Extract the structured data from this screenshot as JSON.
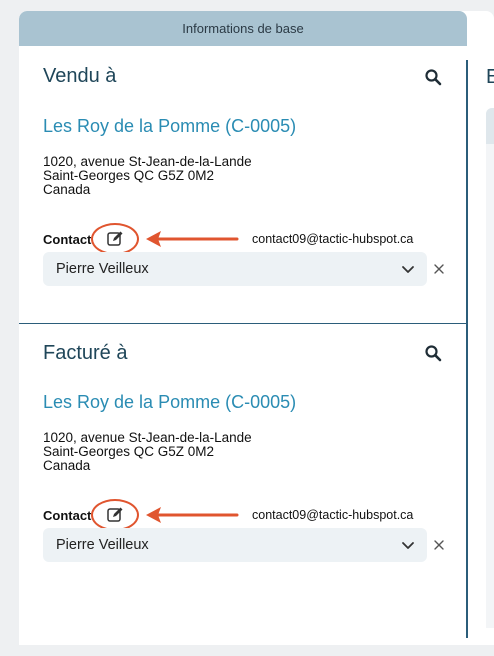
{
  "header": {
    "title": "Informations de base"
  },
  "right_column": {
    "title_fragment": "E"
  },
  "sold_to": {
    "title": "Vendu à",
    "company": "Les Roy de la Pomme (C-0005)",
    "address": [
      "1020, avenue St-Jean-de-la-Lande",
      "Saint-Georges QC  G5Z 0M2",
      "Canada"
    ],
    "contact_label": "Contact",
    "contact_email": "contact09@tactic-hubspot.ca",
    "contact_selected": "Pierre Veilleux"
  },
  "billed_to": {
    "title": "Facturé à",
    "company": "Les Roy de la Pomme (C-0005)",
    "address": [
      "1020, avenue St-Jean-de-la-Lande",
      "Saint-Georges QC  G5Z 0M2",
      "Canada"
    ],
    "contact_label": "Contact",
    "contact_email": "contact09@tactic-hubspot.ca",
    "contact_selected": "Pierre Veilleux"
  },
  "icons": {
    "search": "search-icon",
    "edit": "edit-icon",
    "chevron": "chevron-down-icon",
    "clear": "close-icon"
  },
  "colors": {
    "header_bg": "#a9c3d1",
    "title": "#1f4659",
    "link": "#2a8cb3",
    "annotation": "#e0552f"
  }
}
